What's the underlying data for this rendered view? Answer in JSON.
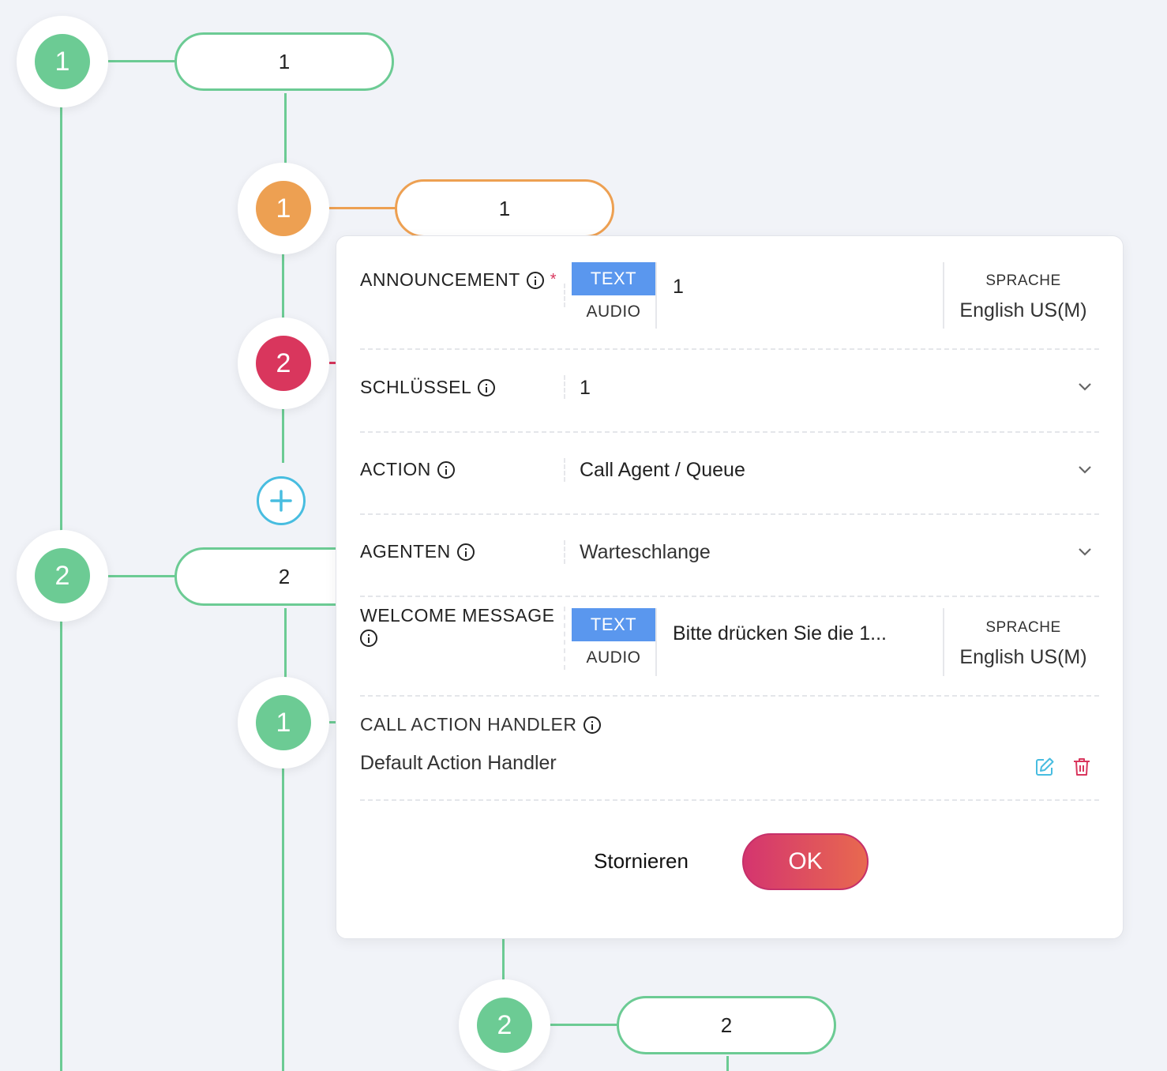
{
  "tree": {
    "nodes": [
      {
        "id": "n-root-1",
        "label": "1",
        "color": "green"
      },
      {
        "id": "n-sub-1",
        "label": "1",
        "color": "orange"
      },
      {
        "id": "n-sub-2",
        "label": "2",
        "color": "red"
      },
      {
        "id": "n-root-2",
        "label": "2",
        "color": "green"
      },
      {
        "id": "n-sub-b1",
        "label": "1",
        "color": "green"
      },
      {
        "id": "n-sub-b2",
        "label": "2",
        "color": "green"
      }
    ],
    "pills": [
      {
        "label": "1"
      },
      {
        "label": "1"
      },
      {
        "label": "2"
      },
      {
        "label": "2"
      }
    ]
  },
  "form": {
    "announcement": {
      "label": "ANNOUNCEMENT",
      "required": "*",
      "mode_text": "TEXT",
      "mode_audio": "AUDIO",
      "value": "1",
      "lang_label": "SPRACHE",
      "lang_value": "English US(M)"
    },
    "key": {
      "label": "SCHLÜSSEL",
      "value": "1"
    },
    "action": {
      "label": "ACTION",
      "value": "Call Agent / Queue"
    },
    "agents": {
      "label": "AGENTEN",
      "value": "Warteschlange"
    },
    "welcome": {
      "label": "WELCOME MESSAGE",
      "mode_text": "TEXT",
      "mode_audio": "AUDIO",
      "value": "Bitte drücken Sie die 1...",
      "lang_label": "SPRACHE",
      "lang_value": "English US(M)"
    },
    "handler": {
      "label": "CALL ACTION HANDLER",
      "value": "Default Action Handler"
    },
    "buttons": {
      "cancel": "Stornieren",
      "ok": "OK"
    }
  },
  "colors": {
    "green": "#6ccb94",
    "orange": "#eda052",
    "red": "#d9365d",
    "accent_blue": "#5a97ee",
    "add_blue": "#48bde0"
  }
}
